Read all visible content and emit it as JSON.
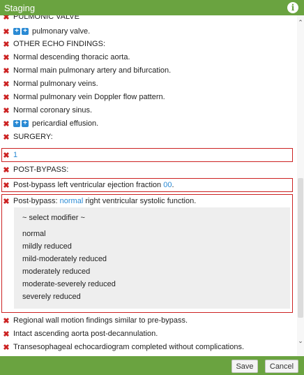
{
  "window": {
    "title": "Staging"
  },
  "report": {
    "lines": [
      {
        "text": "PULMONIC VALVE"
      },
      {
        "text": "pulmonary valve."
      },
      {
        "text": "OTHER ECHO FINDINGS:"
      },
      {
        "text": "Normal descending thoracic aorta."
      },
      {
        "text": "Normal main pulmonary artery and bifurcation."
      },
      {
        "text": "Normal pulmonary veins."
      },
      {
        "text": "Normal pulmonary vein Doppler flow pattern."
      },
      {
        "text": "Normal coronary sinus."
      },
      {
        "text": "pericardial effusion."
      },
      {
        "text": "SURGERY:"
      },
      {
        "text": "1"
      },
      {
        "text": "POST-BYPASS:"
      },
      {
        "text": "Post-bypass left ventricular ejection fraction ",
        "value": "00",
        "suffix": "."
      },
      {
        "text": "Post-bypass: ",
        "value": "normal",
        "suffix": " right ventricular systolic function."
      },
      {
        "text": "Regional wall motion findings similar to pre-bypass."
      },
      {
        "text": "Intact ascending aorta post-decannulation."
      },
      {
        "text": "Transesophageal echocardiogram completed without complications."
      }
    ],
    "plus_glyph": "+"
  },
  "modifier_menu": {
    "header": "~ select modifier ~",
    "options": [
      "normal",
      "mildly reduced",
      "mild-moderately reduced",
      "moderately reduced",
      "moderate-severely reduced",
      "severely reduced"
    ]
  },
  "icons": {
    "remove": "✖",
    "info": "i",
    "scroll_up": "⌃",
    "scroll_down": "⌄"
  },
  "footer": {
    "save_label": "Save",
    "cancel_label": "Cancel"
  },
  "colors": {
    "header": "#6aa340",
    "remove": "#cc2222",
    "link": "#2a8ad4",
    "error_border": "#cc2222"
  }
}
